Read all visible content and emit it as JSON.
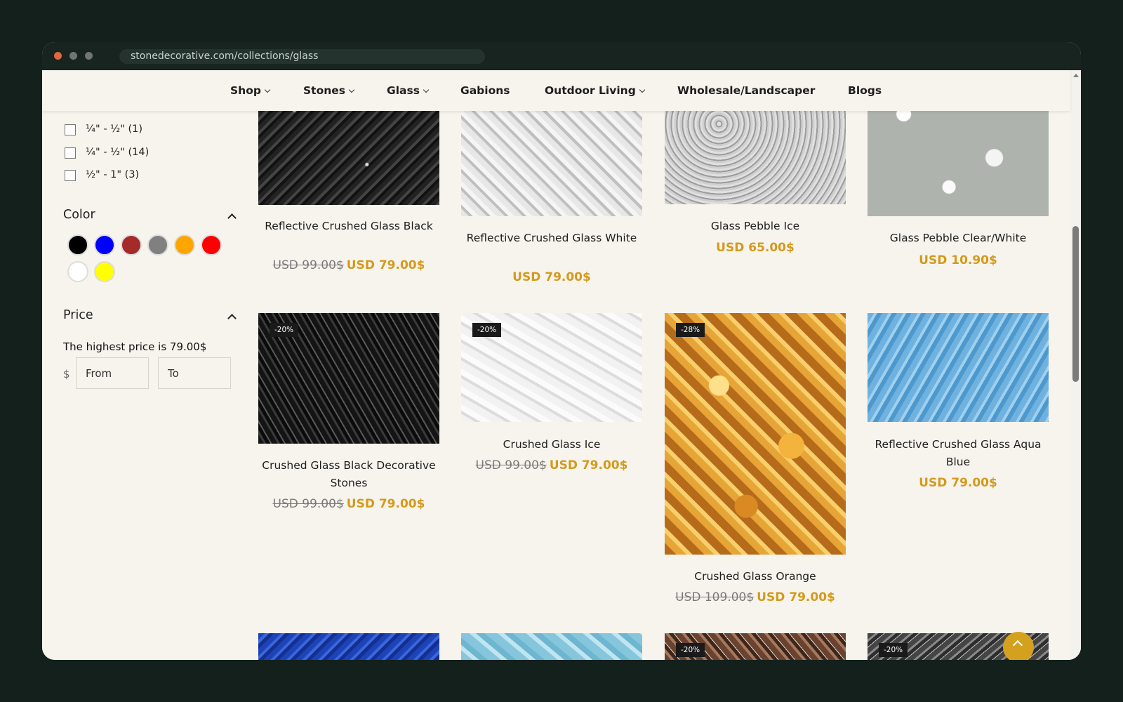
{
  "browser": {
    "url": "stonedecorative.com/collections/glass"
  },
  "nav": {
    "items": [
      {
        "label": "Shop"
      },
      {
        "label": "Stones"
      },
      {
        "label": "Glass"
      },
      {
        "label": "Gabions"
      },
      {
        "label": "Outdoor Living"
      },
      {
        "label": "Wholesale/Landscaper"
      },
      {
        "label": "Blogs"
      }
    ]
  },
  "filters": {
    "size_options": [
      {
        "label": "¼\" - ½\" (1)"
      },
      {
        "label": "¼\" - ½\" (14)"
      },
      {
        "label": "½\" - 1\" (3)"
      }
    ],
    "color": {
      "title": "Color",
      "swatches": [
        "#000000",
        "#0000ff",
        "#a52a2a",
        "#808080",
        "#ffa500",
        "#ff0000",
        "#ffffff",
        "#ffff00"
      ]
    },
    "price": {
      "title": "Price",
      "highest_note": "The highest price is 79.00$",
      "currency": "$",
      "from_placeholder": "From",
      "to_placeholder": "To"
    }
  },
  "products": [
    {
      "name": "Reflective Crushed Glass Black",
      "old_price": "USD 99.00$",
      "price": "USD 79.00$",
      "badge": "",
      "texture": "black-reflect"
    },
    {
      "name": "Reflective Crushed Glass White",
      "old_price": "",
      "price": "USD 79.00$",
      "badge": "",
      "texture": "white-reflect"
    },
    {
      "name": "Glass Pebble Ice",
      "old_price": "",
      "price": "USD 65.00$",
      "badge": "",
      "texture": "pebble-ice"
    },
    {
      "name": "Glass Pebble Clear/White",
      "old_price": "",
      "price": "USD 10.90$",
      "badge": "",
      "texture": "pebble-white"
    },
    {
      "name": "Crushed Glass Black Decorative Stones",
      "old_price": "USD 99.00$",
      "price": "USD 79.00$",
      "badge": "-20%",
      "texture": "black-crushed"
    },
    {
      "name": "Crushed Glass Ice",
      "old_price": "USD 99.00$",
      "price": "USD 79.00$",
      "badge": "-20%",
      "texture": "ice-crushed"
    },
    {
      "name": "Crushed Glass Orange",
      "old_price": "USD 109.00$",
      "price": "USD 79.00$",
      "badge": "-28%",
      "texture": "orange"
    },
    {
      "name": "Reflective Crushed Glass Aqua Blue",
      "old_price": "",
      "price": "USD 79.00$",
      "badge": "",
      "texture": "aqua"
    },
    {
      "name": "",
      "old_price": "",
      "price": "",
      "badge": "",
      "texture": "blue"
    },
    {
      "name": "",
      "old_price": "",
      "price": "",
      "badge": "",
      "texture": "light-aqua"
    },
    {
      "name": "",
      "old_price": "",
      "price": "",
      "badge": "-20%",
      "texture": "bronze"
    },
    {
      "name": "",
      "old_price": "",
      "price": "",
      "badge": "-20%",
      "texture": "gray"
    }
  ]
}
